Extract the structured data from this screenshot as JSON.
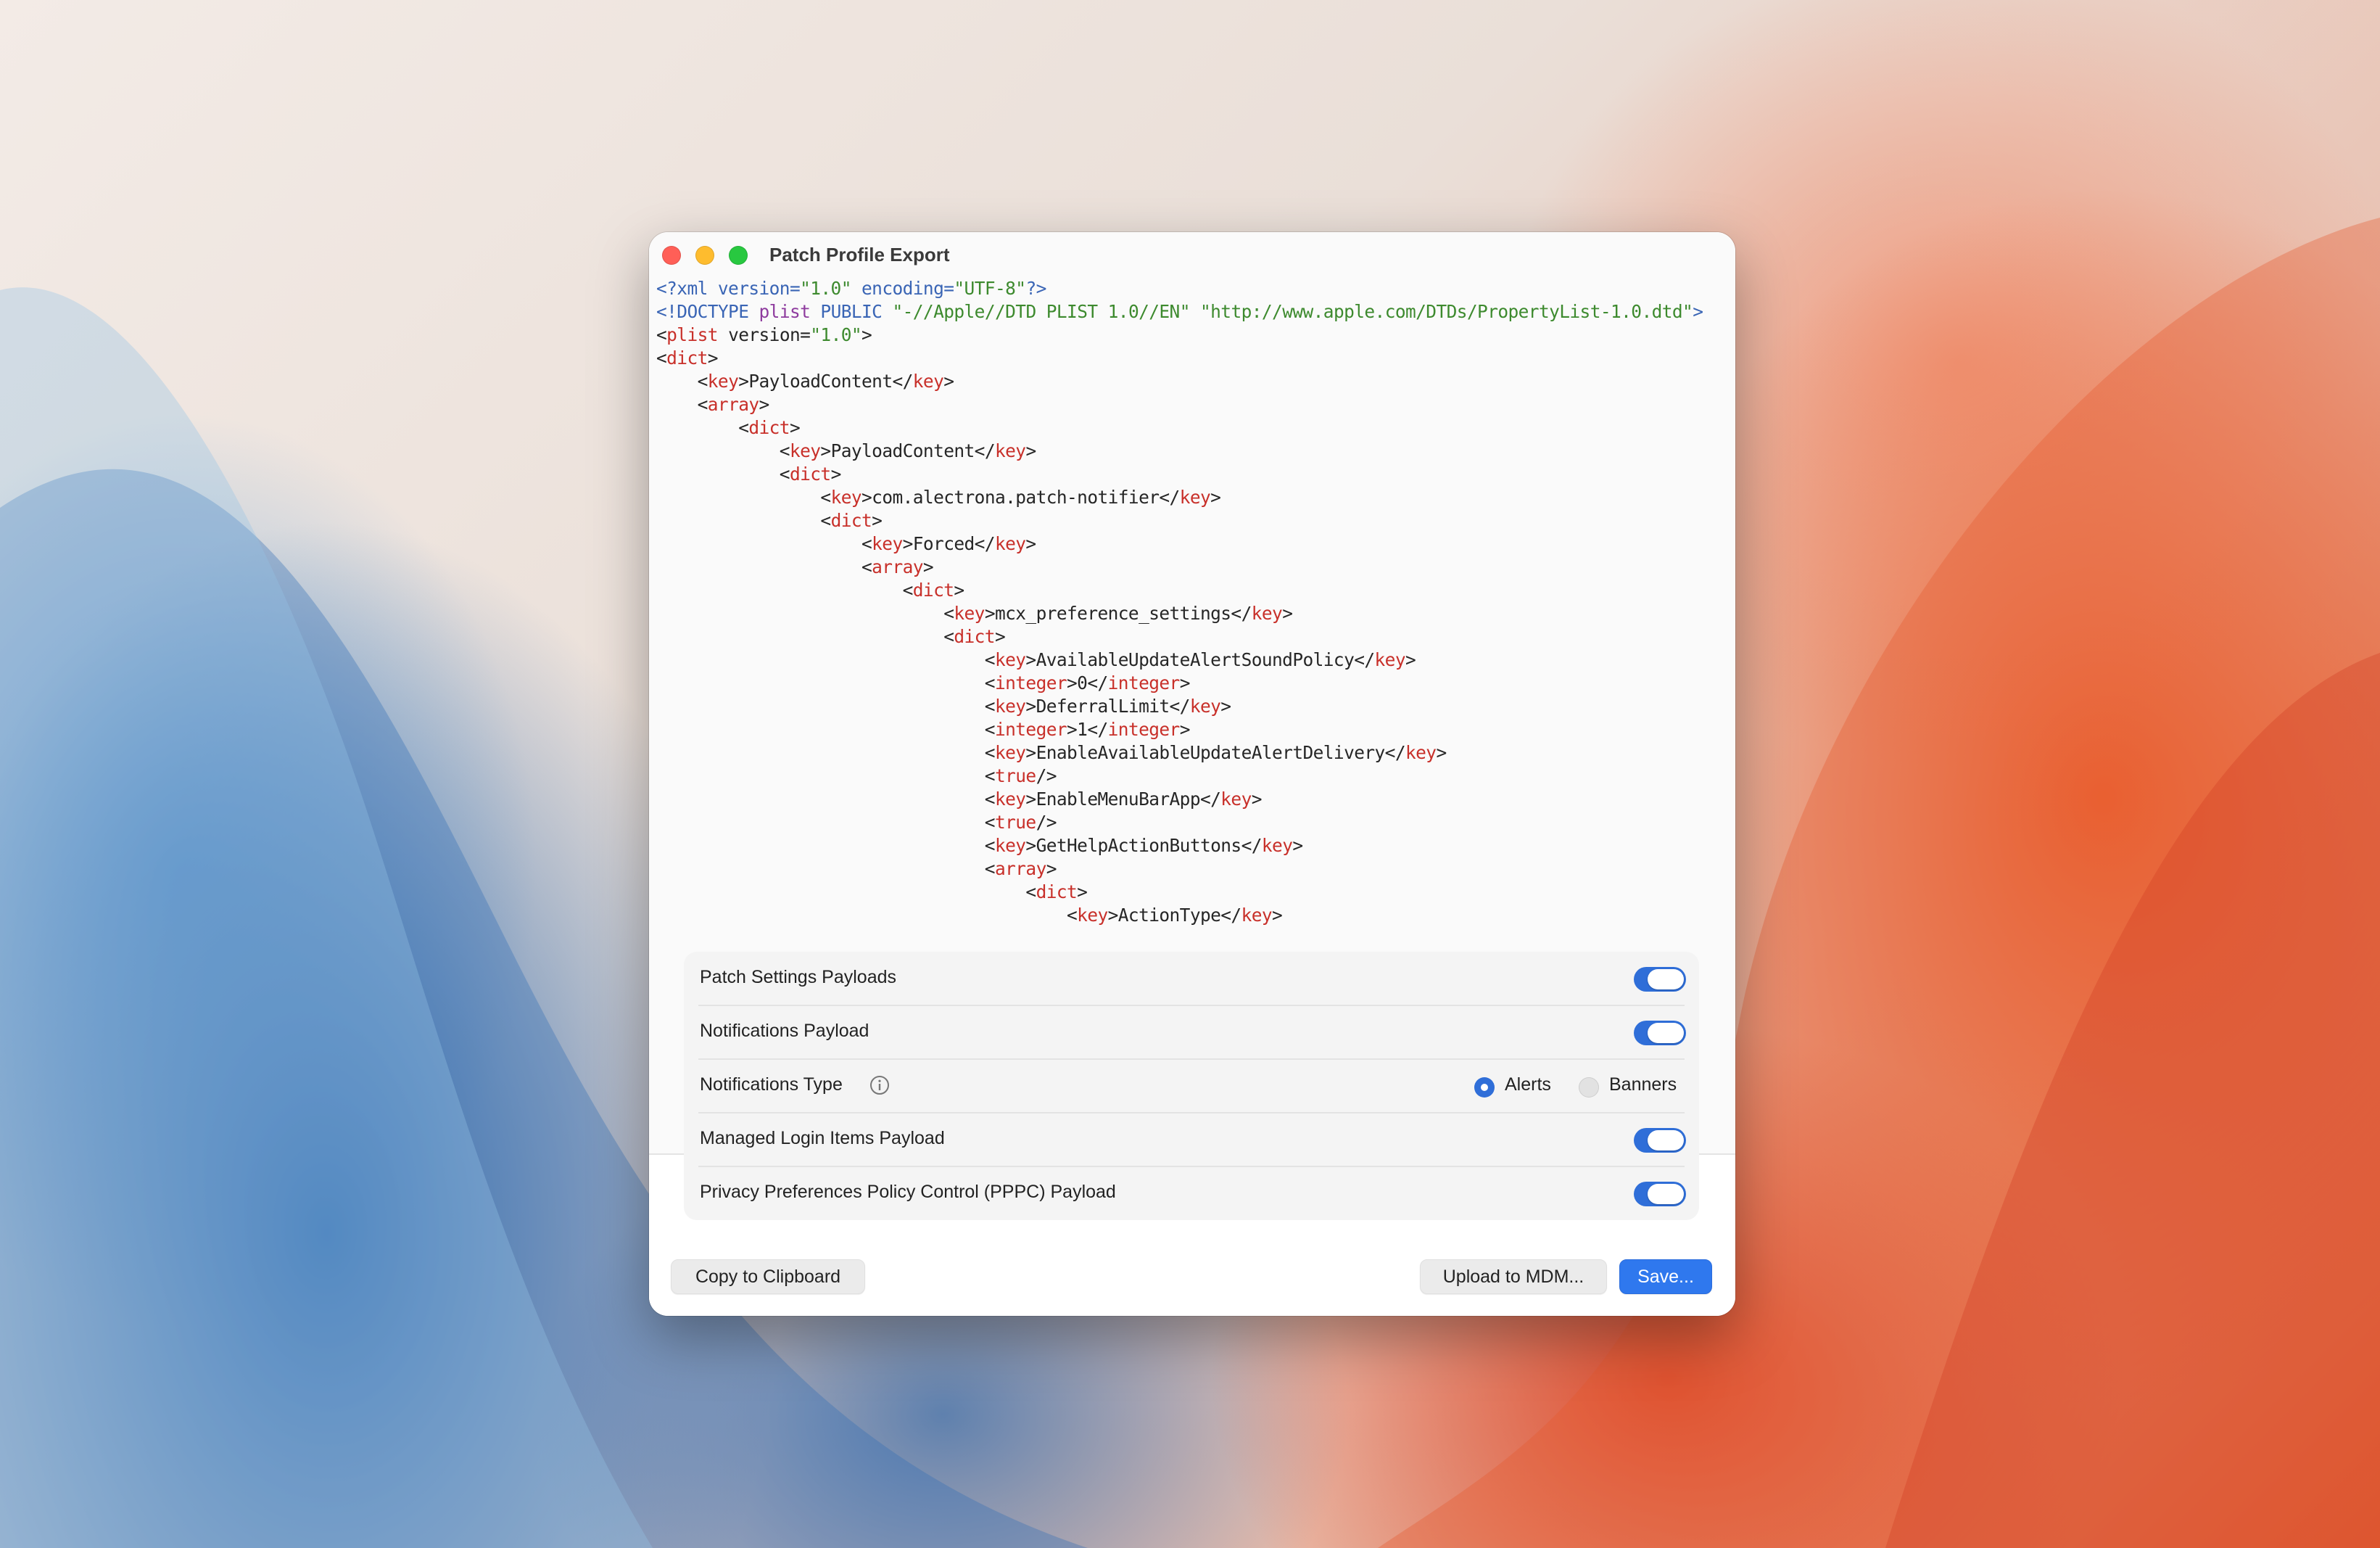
{
  "window": {
    "title": "Patch Profile Export"
  },
  "code_lines": [
    [
      [
        "decl",
        "<?xml version="
      ],
      [
        "str",
        "\"1.0\""
      ],
      [
        "decl",
        " encoding="
      ],
      [
        "str",
        "\"UTF-8\""
      ],
      [
        "decl",
        "?>"
      ]
    ],
    [
      [
        "decl",
        "<!DOCTYPE "
      ],
      [
        "doct",
        "plist"
      ],
      [
        "decl",
        " PUBLIC "
      ],
      [
        "str",
        "\"-//Apple//DTD PLIST 1.0//EN\""
      ],
      [
        "decl",
        " "
      ],
      [
        "str",
        "\"http://www.apple.com/DTDs/PropertyList-1.0.dtd\""
      ],
      [
        "decl",
        ">"
      ]
    ],
    [
      [
        "br",
        "<"
      ],
      [
        "tag",
        "plist"
      ],
      [
        "br",
        " version="
      ],
      [
        "str",
        "\"1.0\""
      ],
      [
        "br",
        ">"
      ]
    ],
    [
      [
        "br",
        "<"
      ],
      [
        "tag",
        "dict"
      ],
      [
        "br",
        ">"
      ]
    ],
    [
      [
        "br",
        "    <"
      ],
      [
        "tag",
        "key"
      ],
      [
        "br",
        ">PayloadContent</"
      ],
      [
        "tag",
        "key"
      ],
      [
        "br",
        ">"
      ]
    ],
    [
      [
        "br",
        "    <"
      ],
      [
        "tag",
        "array"
      ],
      [
        "br",
        ">"
      ]
    ],
    [
      [
        "br",
        "        <"
      ],
      [
        "tag",
        "dict"
      ],
      [
        "br",
        ">"
      ]
    ],
    [
      [
        "br",
        "            <"
      ],
      [
        "tag",
        "key"
      ],
      [
        "br",
        ">PayloadContent</"
      ],
      [
        "tag",
        "key"
      ],
      [
        "br",
        ">"
      ]
    ],
    [
      [
        "br",
        "            <"
      ],
      [
        "tag",
        "dict"
      ],
      [
        "br",
        ">"
      ]
    ],
    [
      [
        "br",
        "                <"
      ],
      [
        "tag",
        "key"
      ],
      [
        "br",
        ">com.alectrona.patch-notifier</"
      ],
      [
        "tag",
        "key"
      ],
      [
        "br",
        ">"
      ]
    ],
    [
      [
        "br",
        "                <"
      ],
      [
        "tag",
        "dict"
      ],
      [
        "br",
        ">"
      ]
    ],
    [
      [
        "br",
        "                    <"
      ],
      [
        "tag",
        "key"
      ],
      [
        "br",
        ">Forced</"
      ],
      [
        "tag",
        "key"
      ],
      [
        "br",
        ">"
      ]
    ],
    [
      [
        "br",
        "                    <"
      ],
      [
        "tag",
        "array"
      ],
      [
        "br",
        ">"
      ]
    ],
    [
      [
        "br",
        "                        <"
      ],
      [
        "tag",
        "dict"
      ],
      [
        "br",
        ">"
      ]
    ],
    [
      [
        "br",
        "                            <"
      ],
      [
        "tag",
        "key"
      ],
      [
        "br",
        ">mcx_preference_settings</"
      ],
      [
        "tag",
        "key"
      ],
      [
        "br",
        ">"
      ]
    ],
    [
      [
        "br",
        "                            <"
      ],
      [
        "tag",
        "dict"
      ],
      [
        "br",
        ">"
      ]
    ],
    [
      [
        "br",
        "                                <"
      ],
      [
        "tag",
        "key"
      ],
      [
        "br",
        ">AvailableUpdateAlertSoundPolicy</"
      ],
      [
        "tag",
        "key"
      ],
      [
        "br",
        ">"
      ]
    ],
    [
      [
        "br",
        "                                <"
      ],
      [
        "tag",
        "integer"
      ],
      [
        "br",
        ">0</"
      ],
      [
        "tag",
        "integer"
      ],
      [
        "br",
        ">"
      ]
    ],
    [
      [
        "br",
        "                                <"
      ],
      [
        "tag",
        "key"
      ],
      [
        "br",
        ">DeferralLimit</"
      ],
      [
        "tag",
        "key"
      ],
      [
        "br",
        ">"
      ]
    ],
    [
      [
        "br",
        "                                <"
      ],
      [
        "tag",
        "integer"
      ],
      [
        "br",
        ">1</"
      ],
      [
        "tag",
        "integer"
      ],
      [
        "br",
        ">"
      ]
    ],
    [
      [
        "br",
        "                                <"
      ],
      [
        "tag",
        "key"
      ],
      [
        "br",
        ">EnableAvailableUpdateAlertDelivery</"
      ],
      [
        "tag",
        "key"
      ],
      [
        "br",
        ">"
      ]
    ],
    [
      [
        "br",
        "                                <"
      ],
      [
        "tag",
        "true"
      ],
      [
        "br",
        "/>"
      ]
    ],
    [
      [
        "br",
        "                                <"
      ],
      [
        "tag",
        "key"
      ],
      [
        "br",
        ">EnableMenuBarApp</"
      ],
      [
        "tag",
        "key"
      ],
      [
        "br",
        ">"
      ]
    ],
    [
      [
        "br",
        "                                <"
      ],
      [
        "tag",
        "true"
      ],
      [
        "br",
        "/>"
      ]
    ],
    [
      [
        "br",
        "                                <"
      ],
      [
        "tag",
        "key"
      ],
      [
        "br",
        ">GetHelpActionButtons</"
      ],
      [
        "tag",
        "key"
      ],
      [
        "br",
        ">"
      ]
    ],
    [
      [
        "br",
        "                                <"
      ],
      [
        "tag",
        "array"
      ],
      [
        "br",
        ">"
      ]
    ],
    [
      [
        "br",
        "                                    <"
      ],
      [
        "tag",
        "dict"
      ],
      [
        "br",
        ">"
      ]
    ],
    [
      [
        "br",
        "                                        <"
      ],
      [
        "tag",
        "key"
      ],
      [
        "br",
        ">ActionType</"
      ],
      [
        "tag",
        "key"
      ],
      [
        "br",
        ">"
      ]
    ]
  ],
  "settings": {
    "patch_settings_label": "Patch Settings Payloads",
    "patch_settings_on": true,
    "notifications_payload_label": "Notifications Payload",
    "notifications_payload_on": true,
    "notifications_type_label": "Notifications Type",
    "alerts_label": "Alerts",
    "banners_label": "Banners",
    "selected_type": "Alerts",
    "managed_login_label": "Managed Login Items Payload",
    "managed_login_on": true,
    "pppc_label": "Privacy Preferences Policy Control (PPPC) Payload",
    "pppc_on": true
  },
  "buttons": {
    "copy": "Copy to Clipboard",
    "upload": "Upload to MDM...",
    "save": "Save..."
  },
  "colors": {
    "accent": "#2f6ed8",
    "tag": "#c8302a",
    "string": "#3d8a2e",
    "declaration": "#3a65b5",
    "doctype": "#8e3b9e"
  }
}
